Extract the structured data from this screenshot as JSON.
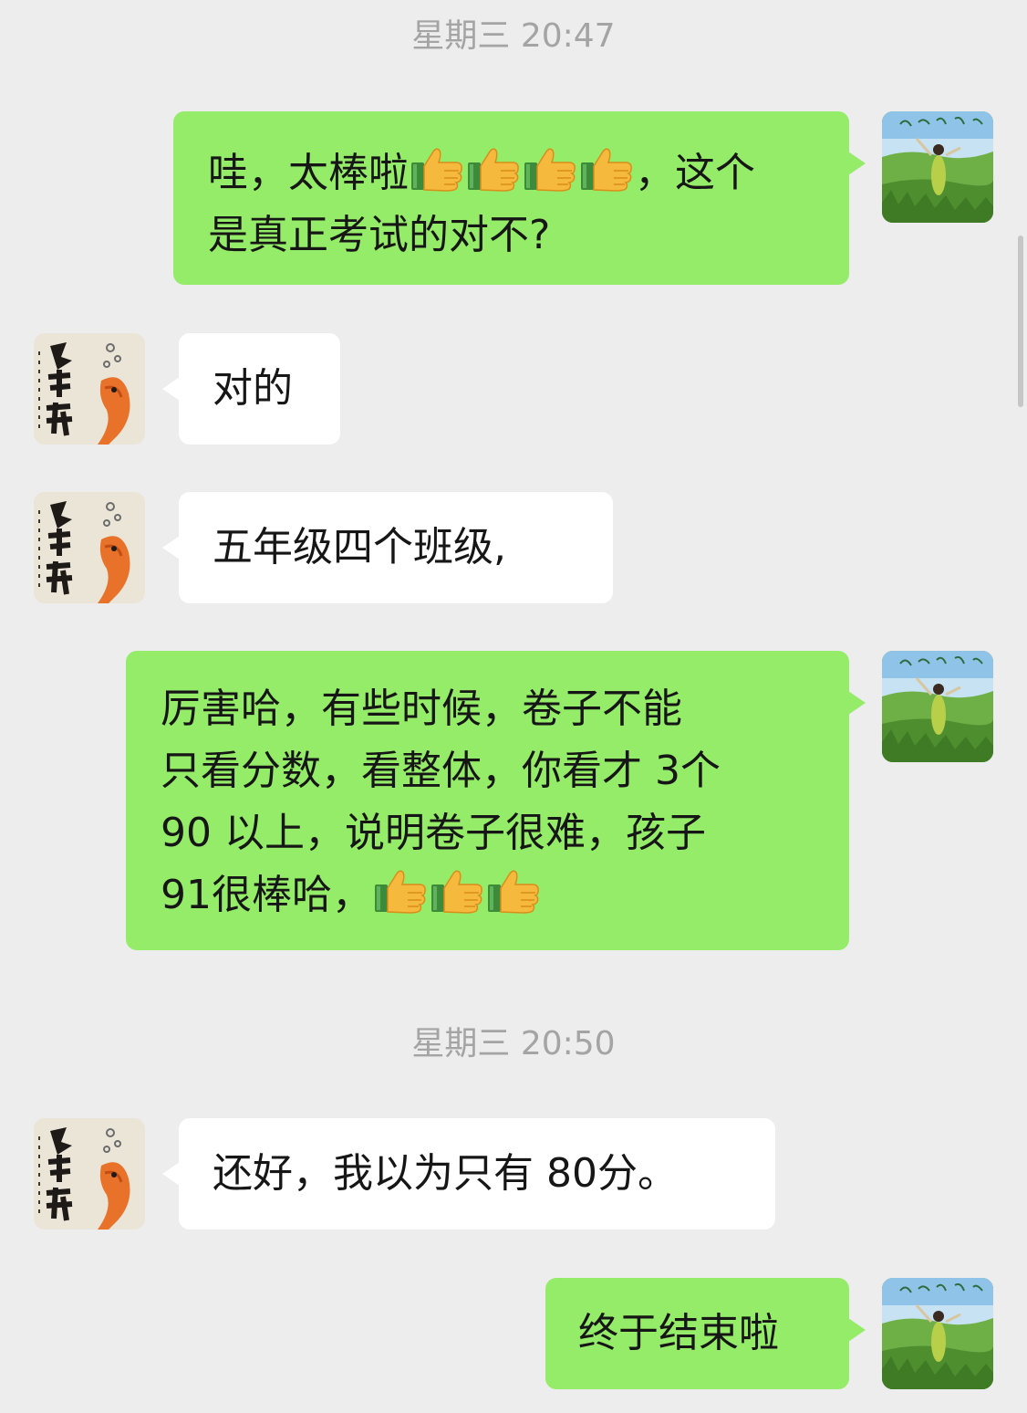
{
  "chat": {
    "timestamps": [
      "星期三 20:47",
      "星期三 20:50"
    ],
    "messages": [
      {
        "side": "out",
        "text_1a": "哇，太棒啦",
        "text_1b": "，这个",
        "text_2": "是真正考试的对不?"
      },
      {
        "side": "in",
        "text": "对的"
      },
      {
        "side": "in",
        "text": "五年级四个班级,"
      },
      {
        "side": "out",
        "lines": [
          "厉害哈，有些时候，卷子不能",
          "只看分数，看整体，你看才 3个",
          "90 以上，说明卷子很难，孩子",
          "91很棒哈，"
        ]
      },
      {
        "side": "in",
        "text": "还好，我以为只有 80分。"
      },
      {
        "side": "out",
        "text": "终于结束啦"
      }
    ]
  },
  "icons": {
    "thumbs_up": "thumbs-up-emoji",
    "my_avatar": "grassland-avatar",
    "contact_avatar": "calligraphy-koi-avatar"
  },
  "colors": {
    "background": "#ededed",
    "out_bubble": "#95ec69",
    "in_bubble": "#ffffff",
    "timestamp": "#a4a4a4"
  }
}
